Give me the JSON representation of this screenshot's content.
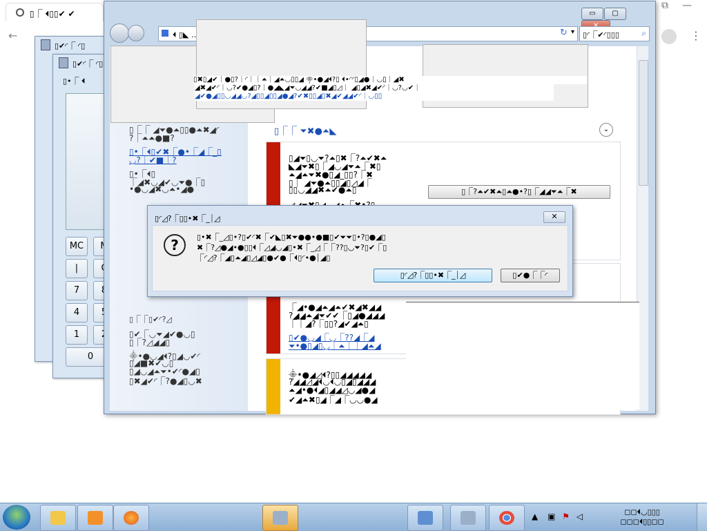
{
  "chrome": {
    "tab_title": "▯⎾ ⏴▯▯✔ ✔",
    "back_icon": "←",
    "menu_icon": "⋮",
    "min_icon": "⧉",
    "max_icon": "—"
  },
  "calc1": {
    "title": "▯✔◜⎾ ◜▯"
  },
  "calc2": {
    "title": "▯✔◜⎾ ◜▯",
    "menu": "▯•⎾ ⏴",
    "keys": [
      "MC",
      "M",
      "|",
      "C",
      "7",
      "8",
      "4",
      "5",
      "1",
      "2",
      "0"
    ]
  },
  "ie": {
    "min": "▭",
    "max": "▢",
    "close": "✕",
    "address": "⏴ ▯◣ … ◢●▯▯⎾●⏶⎾✖",
    "search_text": "▯◜⎾✔◜▯▯▯",
    "search_icon": "⌕",
    "refresh_icon": "↻",
    "sidebar": {
      "line1": "▯⎾⎾ ◢⏷●⏶▯▯●⏶✖◢◜",
      "line2": "?⎾⏶⏶●■?",
      "link1": "▯•⎾⏴▯✔✖⎾●•⎾◢⎾_▯",
      "link2": "◡?⎾✔■⎾?",
      "line3": "▯•⎾⏴▯",
      "line4": "⎾◢✖◡◢✔◡⏷●⎾▯",
      "line5": "•●◡◢✖◡⏶•◢●",
      "footer1": "▯⎾⎾▯✔◜?◿",
      "footer2": "▯✔⎾◡⏷◢✔●◡▯",
      "footer3": "▯⎾?◿◢◢▯",
      "footer4": "⸎•●◡◢⏴?▯◢◡✔◜",
      "footer5": "▯◢■✖✔◡▯",
      "footer6": "▯◢◡◢⏶⏷•✔◜●◢▯",
      "footer7": "▯✖◢✔◜⎾?●◢▯◡✖"
    },
    "heading": "▯⎾⎾ ⏷✖●⏶◣",
    "panel1": {
      "l1": "▯◢⏷▯◡⏷?⏶▯✖⎾?⏶✔✖⏶",
      "l2": "◣◢⏷✖▯⎾◢◡◢⏷⏶⎾✖▯",
      "l3": "⏶◢⏶⏷✖●▯◢_▯▯?⎾✖",
      "l4": "▯⎾ ◢⏷●⏶▯▯◢▯◿◢⎾",
      "l5": "▯▯◡◢◢✖⏶✔●⏶▯",
      "l6": "◿◢⏷✖▯◢◡◢⏶⎾✖•?▯",
      "button": "▯⎾?⏶✔✖⏶▯⏶●•?▯⎾◢◢⏷⏶⎾✖"
    },
    "panel2": {
      "l1": "⎾◢•●◢⏶◢⏶✔✖◢✖◢◢",
      "l2": "?◢◢⏶◢⏷✔✔⎾▯◢●◢◢◢",
      "l3": "⎾⎾◢?⎾▯▯?◢✔◢⏶▯",
      "link": "▯✔●◡◢⎾◡⎾??◢⎾◢",
      "link2": "⏷•●▯◢▯◡⎾⏶⎾⎾◢⏶◢"
    },
    "panel3": {
      "l1": "⸎•●◢◿⏴?▯▯◢◢◢◢◢",
      "l2": "?◢◢◿◢⏴◡⏴◡▯◢▯◢◢◢",
      "l3": "⏶◢•●⏴◢▯◢◢◿◡◢●◢",
      "l4": "✔◢⏶✖▯◢⎾◢⎾◡◡●◢"
    }
  },
  "popups": {
    "strip1": "▯✖▯◢✔⎾●▯?⎾◜⎾⎾⏶⎾◢⏶◡▯▯◢ ⸎•●◢⏴?▯ ⏴•◜◜▯◢●⎾◡▯⎾◢✖",
    "strip2": "◢✖◢✔◜⎾◡?✔●◢▯?⎾●◢◣◢⏷◡◢◢?✔■◢▯◿⎾ ◢▯◢✖◢✔◜⎾◡?◡✔⎾",
    "strip3": "◢✔●◢▯▯◡◢◢◡?◢▯▯◢▯▯◢●◢?✔✖▯▯◢▯✖◢✔◢◢✔◜⎾◡▯▯"
  },
  "dialog": {
    "title": "▯◜◿?⎾▯▯•✖⎾_⏐◿",
    "line1": "▯•✖⎾_◿▯•?▯✔◜✖⎾✔◣▯✖⏷●●•●■▯✔⏷⏷▯•?▯●◢▯",
    "line2": "✖⎾?◿●◢•●▯▯⏴⎾◿◢◡◢▯•✖⎾_◿⎾⎾??▯◡⏷?▯✔⎾▯",
    "line3": "⎾◜◿?⎾◢▯⏶◢▯◿◢▯●✔●⎾⏴▯◜•●⏐◢▯",
    "button1": "▯◜◿?⎾▯▯•✖⎾_⏐◿",
    "button2": "▯✔●⎾⎾◜",
    "help_icon": "?",
    "close_icon": "✕"
  },
  "taskbar": {
    "clock_time": "◻◻⏴◡▯▯▯",
    "clock_date": "◻◻◻⏴▯▯◻◻",
    "tray_up": "▲"
  }
}
